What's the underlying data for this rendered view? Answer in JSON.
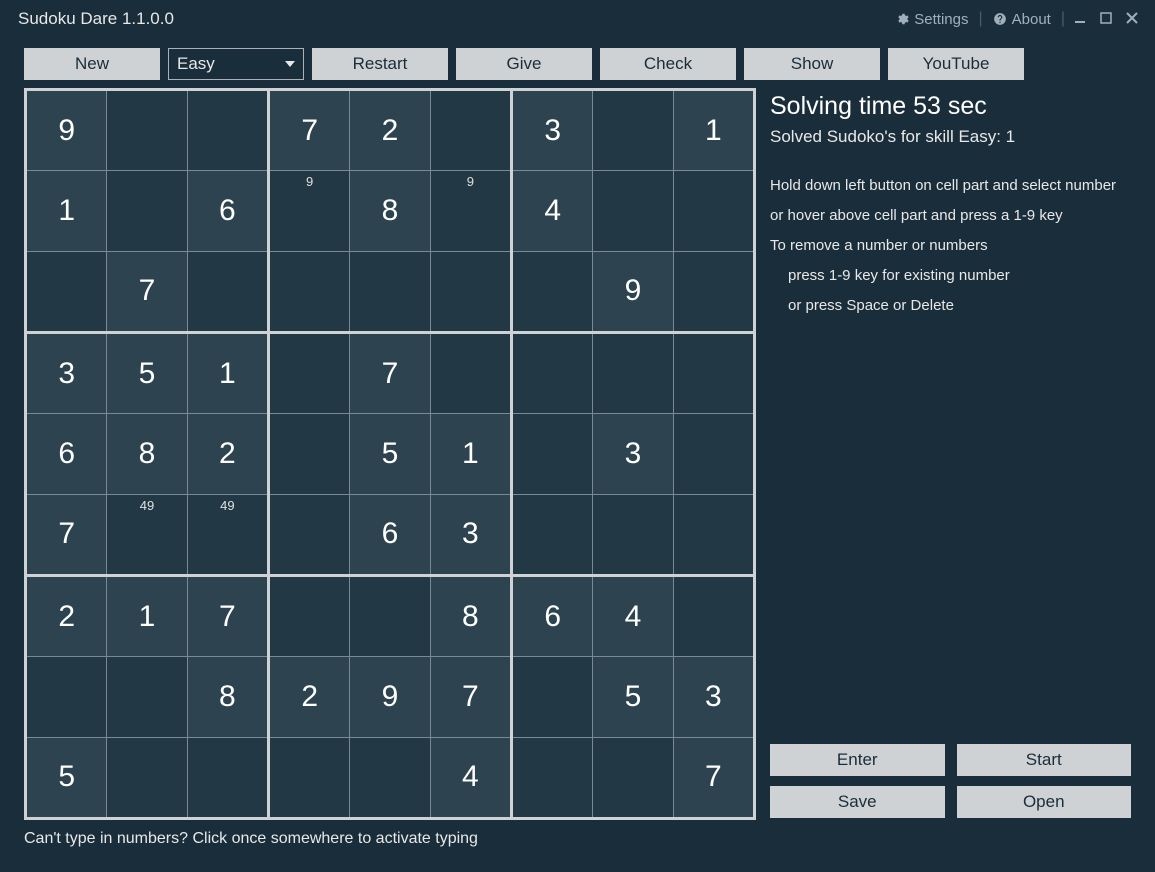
{
  "titlebar": {
    "title": "Sudoku Dare 1.1.0.0",
    "settings": "Settings",
    "about": "About"
  },
  "toolbar": {
    "new": "New",
    "difficulty_selected": "Easy",
    "restart": "Restart",
    "give": "Give",
    "check": "Check",
    "show": "Show",
    "youtube": "YouTube"
  },
  "board": {
    "grid": [
      [
        {
          "v": "9",
          "g": true
        },
        {
          "v": ""
        },
        {
          "v": ""
        },
        {
          "v": "7",
          "g": true
        },
        {
          "v": "2",
          "g": true
        },
        {
          "v": ""
        },
        {
          "v": "3",
          "g": true
        },
        {
          "v": ""
        },
        {
          "v": "1",
          "g": true
        }
      ],
      [
        {
          "v": "1",
          "g": true
        },
        {
          "v": ""
        },
        {
          "v": "6",
          "g": true
        },
        {
          "v": "",
          "c": "9"
        },
        {
          "v": "8",
          "g": true
        },
        {
          "v": "",
          "c": "9"
        },
        {
          "v": "4",
          "g": true
        },
        {
          "v": ""
        },
        {
          "v": ""
        }
      ],
      [
        {
          "v": ""
        },
        {
          "v": "7",
          "g": true
        },
        {
          "v": ""
        },
        {
          "v": ""
        },
        {
          "v": ""
        },
        {
          "v": ""
        },
        {
          "v": ""
        },
        {
          "v": "9",
          "g": true
        },
        {
          "v": ""
        }
      ],
      [
        {
          "v": "3",
          "g": true
        },
        {
          "v": "5",
          "g": true
        },
        {
          "v": "1",
          "g": true
        },
        {
          "v": ""
        },
        {
          "v": "7",
          "g": true
        },
        {
          "v": ""
        },
        {
          "v": ""
        },
        {
          "v": ""
        },
        {
          "v": ""
        }
      ],
      [
        {
          "v": "6",
          "g": true
        },
        {
          "v": "8",
          "g": true
        },
        {
          "v": "2",
          "g": true
        },
        {
          "v": ""
        },
        {
          "v": "5",
          "g": true
        },
        {
          "v": "1",
          "g": true
        },
        {
          "v": ""
        },
        {
          "v": "3",
          "g": true
        },
        {
          "v": ""
        }
      ],
      [
        {
          "v": "7",
          "g": true
        },
        {
          "v": "",
          "c": "49"
        },
        {
          "v": "",
          "c": "49"
        },
        {
          "v": ""
        },
        {
          "v": "6",
          "g": true
        },
        {
          "v": "3",
          "g": true
        },
        {
          "v": ""
        },
        {
          "v": ""
        },
        {
          "v": ""
        }
      ],
      [
        {
          "v": "2",
          "g": true
        },
        {
          "v": "1",
          "g": true
        },
        {
          "v": "7",
          "g": true
        },
        {
          "v": ""
        },
        {
          "v": ""
        },
        {
          "v": "8",
          "g": true
        },
        {
          "v": "6",
          "g": true
        },
        {
          "v": "4",
          "g": true
        },
        {
          "v": ""
        }
      ],
      [
        {
          "v": ""
        },
        {
          "v": ""
        },
        {
          "v": "8",
          "g": true
        },
        {
          "v": "2",
          "g": true
        },
        {
          "v": "9",
          "g": true
        },
        {
          "v": "7",
          "g": true
        },
        {
          "v": ""
        },
        {
          "v": "5",
          "g": true
        },
        {
          "v": "3",
          "g": true
        }
      ],
      [
        {
          "v": "5",
          "g": true
        },
        {
          "v": ""
        },
        {
          "v": ""
        },
        {
          "v": ""
        },
        {
          "v": ""
        },
        {
          "v": "4",
          "g": true
        },
        {
          "v": ""
        },
        {
          "v": ""
        },
        {
          "v": "7",
          "g": true
        }
      ]
    ]
  },
  "side": {
    "solving_time": "Solving time 53 sec",
    "solved_stat": "Solved Sudoko's for skill Easy: 1",
    "help1": "Hold down left button on cell part and select number",
    "help2": "or hover above cell part and press a 1-9 key",
    "help3": "To remove a number or numbers",
    "help4": "press 1-9 key for existing number",
    "help5": "or press Space or Delete",
    "buttons": {
      "enter": "Enter",
      "start": "Start",
      "save": "Save",
      "open": "Open"
    }
  },
  "footer": {
    "hint": "Can't type in numbers? Click once somewhere to activate typing"
  }
}
